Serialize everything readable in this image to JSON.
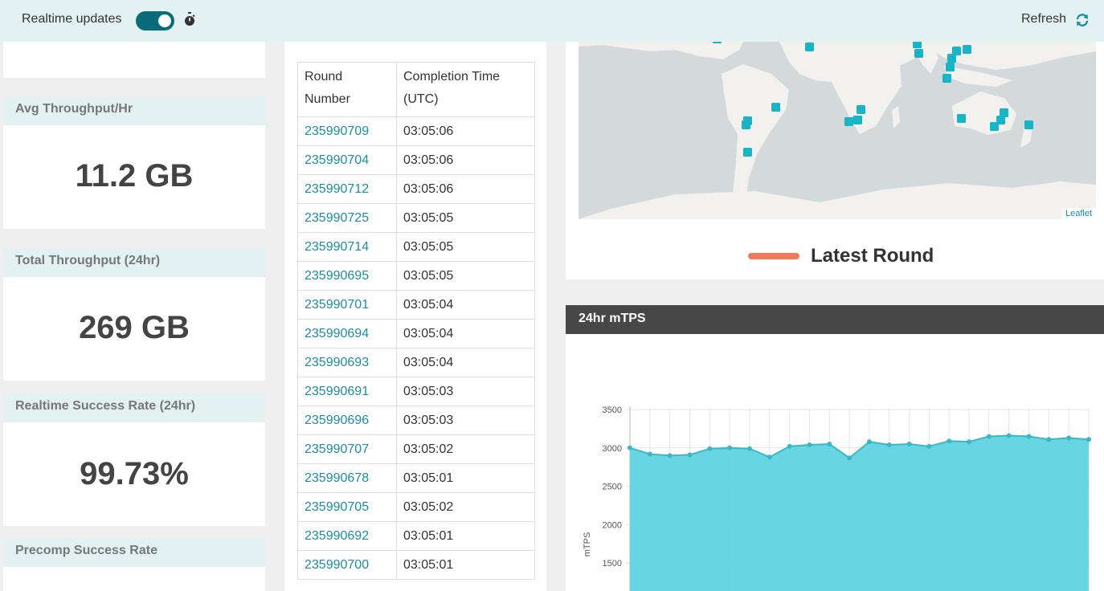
{
  "topbar": {
    "realtime_label": "Realtime updates",
    "realtime_on": true,
    "refresh_label": "Refresh"
  },
  "stats": {
    "avg_throughput": {
      "title": "Avg Throughput/Hr",
      "value": "11.2 GB"
    },
    "total_throughput": {
      "title": "Total Throughput (24hr)",
      "value": "269 GB"
    },
    "realtime_success": {
      "title": "Realtime Success Rate (24hr)",
      "value": "99.73%"
    },
    "precomp_success": {
      "title": "Precomp Success Rate"
    }
  },
  "rounds_table": {
    "headers": [
      "Round Number",
      "Completion Time (UTC)"
    ],
    "rows": [
      {
        "round": "235990709",
        "time": "03:05:06"
      },
      {
        "round": "235990704",
        "time": "03:05:06"
      },
      {
        "round": "235990712",
        "time": "03:05:06"
      },
      {
        "round": "235990725",
        "time": "03:05:05"
      },
      {
        "round": "235990714",
        "time": "03:05:05"
      },
      {
        "round": "235990695",
        "time": "03:05:05"
      },
      {
        "round": "235990701",
        "time": "03:05:04"
      },
      {
        "round": "235990694",
        "time": "03:05:04"
      },
      {
        "round": "235990693",
        "time": "03:05:04"
      },
      {
        "round": "235990691",
        "time": "03:05:03"
      },
      {
        "round": "235990696",
        "time": "03:05:03"
      },
      {
        "round": "235990707",
        "time": "03:05:02"
      },
      {
        "round": "235990678",
        "time": "03:05:01"
      },
      {
        "round": "235990705",
        "time": "03:05:02"
      },
      {
        "round": "235990692",
        "time": "03:05:01"
      },
      {
        "round": "235990700",
        "time": "03:05:01"
      }
    ]
  },
  "map": {
    "attribution": "Leaflet",
    "legend_label": "Latest Round",
    "legend_color": "#f4795b",
    "marker_color": "#17b5c6"
  },
  "chart_data": {
    "type": "area",
    "title": "24hr mTPS",
    "ylabel": "mTPS",
    "xlabel": "",
    "ylim": [
      1000,
      3500
    ],
    "yticks": [
      1500,
      2000,
      2500,
      3000,
      3500
    ],
    "values": [
      3000,
      2920,
      2900,
      2910,
      2990,
      3000,
      2990,
      2880,
      3020,
      3040,
      3050,
      2870,
      3080,
      3040,
      3050,
      3020,
      3090,
      3080,
      3150,
      3160,
      3150,
      3110,
      3130,
      3110
    ],
    "fill_color": "#5fd3e0",
    "line_color": "#3bb7c7"
  },
  "colors": {
    "accent": "#0b6b7a",
    "link": "#1a8fa3",
    "header_bg": "#e3f1f3"
  }
}
